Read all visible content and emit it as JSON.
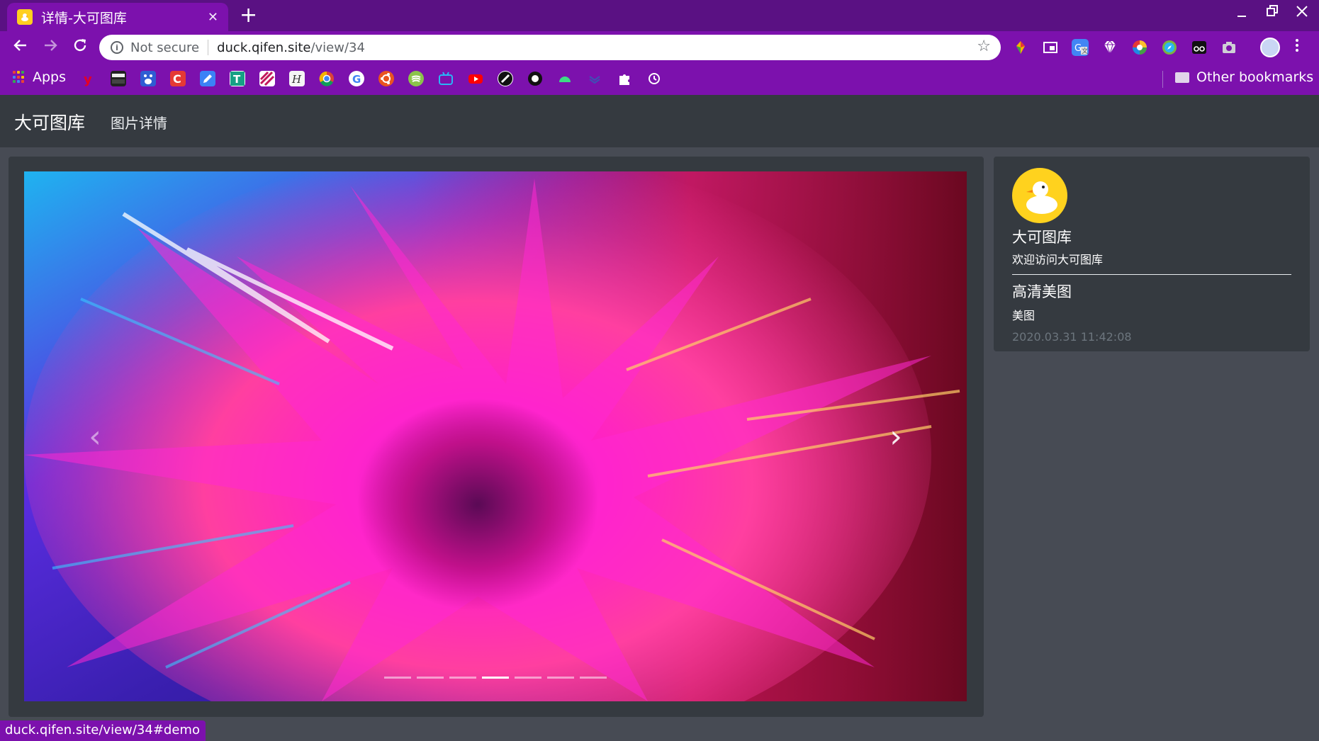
{
  "browser": {
    "tab_title": "详情-大可图库",
    "tab_close": "✕",
    "new_tab": "+",
    "not_secure": "Not secure",
    "url_host": "duck.qifen.site",
    "url_path": "/view/34",
    "apps_label": "Apps",
    "other_bookmarks": "Other bookmarks",
    "status_url": "duck.qifen.site/view/34#demo"
  },
  "navbar": {
    "brand": "大可图库",
    "link": "图片详情"
  },
  "carousel": {
    "prev_icon": "‹",
    "next_icon": "›",
    "indicator_count": 7,
    "active_index": 3
  },
  "sidebar": {
    "site_name": "大可图库",
    "site_desc": "欢迎访问大可图库",
    "image_title": "高清美图",
    "image_category": "美图",
    "timestamp": "2020.03.31 11:42:08"
  }
}
